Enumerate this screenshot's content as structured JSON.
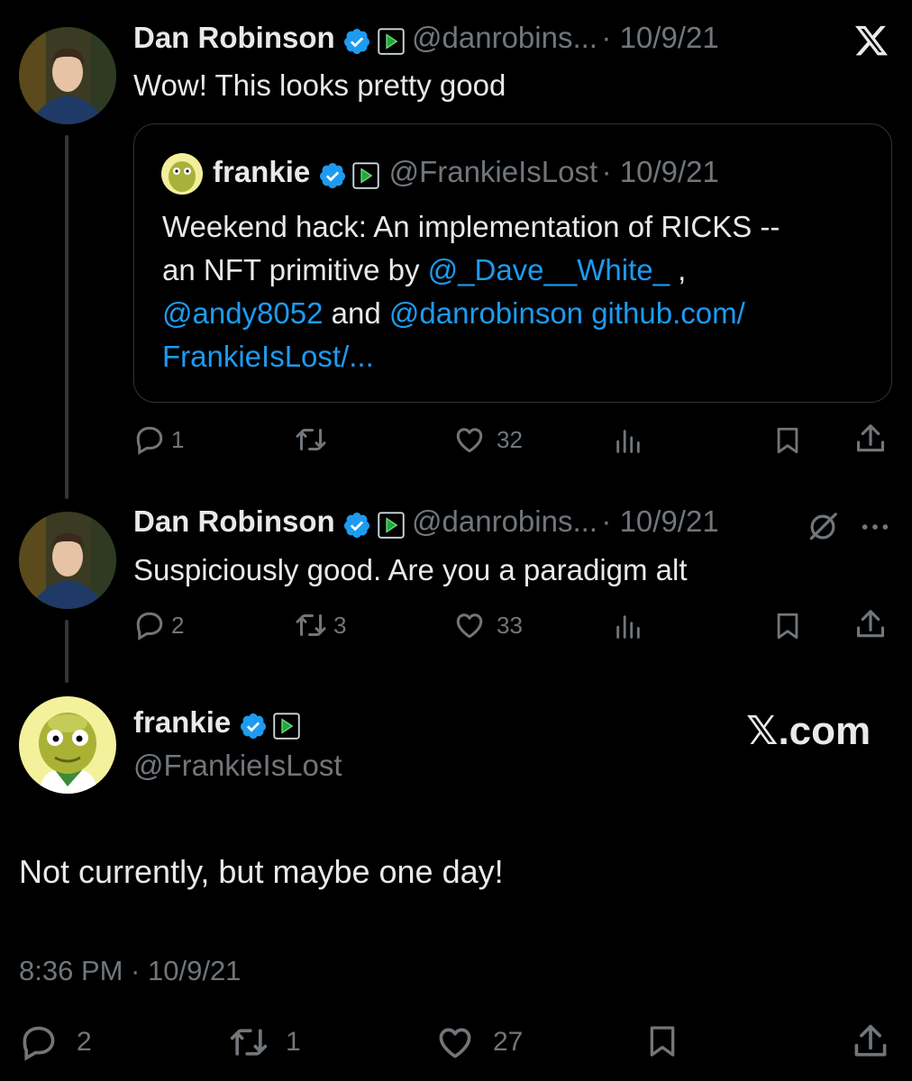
{
  "tweet1": {
    "name": "Dan Robinson",
    "handle": "@danrobins...",
    "date": "· 10/9/21",
    "text": "Wow! This looks pretty good",
    "quote": {
      "name": "frankie",
      "handle": "@FrankieIsLost",
      "date": "· 10/9/21",
      "line1": "Weekend hack: An implementation of RICKS --",
      "line2_a": "an NFT primitive by ",
      "line2_link": "@_Dave__White_",
      "line2_b": " ,",
      "line3_link1": "@andy8052",
      "line3_mid": " and ",
      "line3_link2": "@danrobinson github.com/",
      "line4_link": "FrankieIsLost/..."
    },
    "replies": "1",
    "retweets": "",
    "likes": "32"
  },
  "tweet2": {
    "name": "Dan Robinson",
    "handle": "@danrobins...",
    "date": "· 10/9/21",
    "text": "Suspiciously good. Are you a paradigm alt",
    "replies": "2",
    "retweets": "3",
    "likes": "33"
  },
  "main": {
    "name": "frankie",
    "handle": "@FrankieIsLost",
    "brand": "𝕏.com",
    "text": "Not currently, but maybe one day!",
    "timestamp": "8:36 PM · 10/9/21",
    "replies": "2",
    "retweets": "1",
    "likes": "27"
  },
  "colors": {
    "verified": "#1d9bf0",
    "link": "#1d9bf0",
    "muted": "#71767b",
    "background": "#000000"
  },
  "icons": [
    "x-logo-icon",
    "verified-icon",
    "affiliate-badge-icon",
    "reply-icon",
    "retweet-icon",
    "like-icon",
    "views-icon",
    "bookmark-icon",
    "share-icon",
    "grok-icon",
    "more-icon"
  ]
}
